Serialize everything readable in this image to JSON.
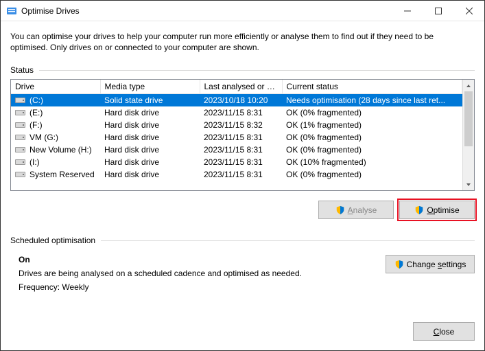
{
  "window": {
    "title": "Optimise Drives"
  },
  "intro": "You can optimise your drives to help your computer run more efficiently or analyse them to find out if they need to be optimised. Only drives on or connected to your computer are shown.",
  "status_label": "Status",
  "columns": {
    "drive": "Drive",
    "media": "Media type",
    "last": "Last analysed or o...",
    "status": "Current status"
  },
  "drives": [
    {
      "name": "(C:)",
      "media": "Solid state drive",
      "last": "2023/10/18 10:20",
      "status": "Needs optimisation (28 days since last ret...",
      "selected": true
    },
    {
      "name": "(E:)",
      "media": "Hard disk drive",
      "last": "2023/11/15 8:31",
      "status": "OK (0% fragmented)",
      "selected": false
    },
    {
      "name": "(F:)",
      "media": "Hard disk drive",
      "last": "2023/11/15 8:32",
      "status": "OK (1% fragmented)",
      "selected": false
    },
    {
      "name": "VM (G:)",
      "media": "Hard disk drive",
      "last": "2023/11/15 8:31",
      "status": "OK (0% fragmented)",
      "selected": false
    },
    {
      "name": "New Volume (H:)",
      "media": "Hard disk drive",
      "last": "2023/11/15 8:31",
      "status": "OK (0% fragmented)",
      "selected": false
    },
    {
      "name": "(I:)",
      "media": "Hard disk drive",
      "last": "2023/11/15 8:31",
      "status": "OK (10% fragmented)",
      "selected": false
    },
    {
      "name": "System Reserved",
      "media": "Hard disk drive",
      "last": "2023/11/15 8:31",
      "status": "OK (0% fragmented)",
      "selected": false
    }
  ],
  "buttons": {
    "analyse": "Analyse",
    "optimise": "Optimise",
    "change_settings": "Change settings",
    "close": "Close"
  },
  "schedule": {
    "label": "Scheduled optimisation",
    "state": "On",
    "desc": "Drives are being analysed on a scheduled cadence and optimised as needed.",
    "freq": "Frequency: Weekly"
  }
}
